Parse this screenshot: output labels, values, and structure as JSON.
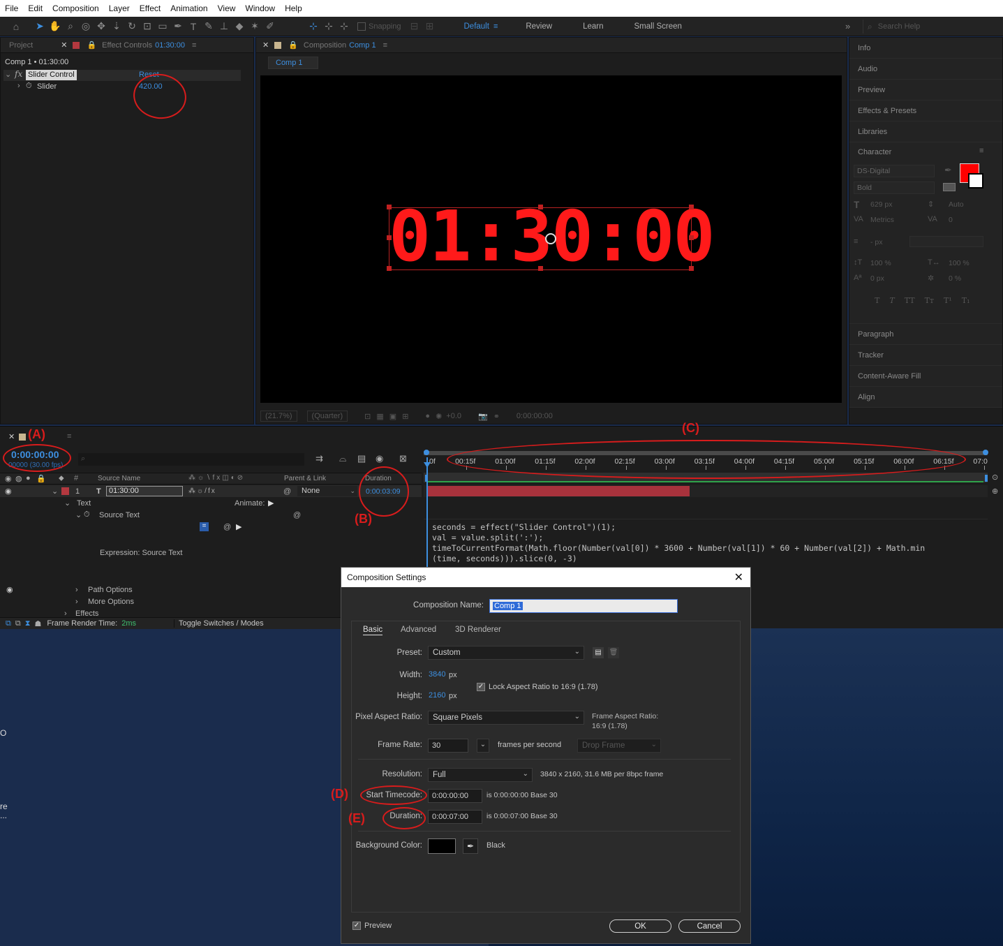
{
  "menu": [
    "File",
    "Edit",
    "Composition",
    "Layer",
    "Effect",
    "Animation",
    "View",
    "Window",
    "Help"
  ],
  "toolbar": {
    "snapping": "Snapping",
    "workspaces": [
      "Default",
      "Review",
      "Learn",
      "Small Screen"
    ],
    "search_placeholder": "Search Help"
  },
  "project_panel": {
    "tab_project": "Project",
    "tab_effect_controls": "Effect Controls",
    "effect_layer": "01:30:00",
    "comp_label": "Comp 1 • 01:30:00",
    "effect_name": "Slider Control",
    "reset": "Reset",
    "slider_label": "Slider",
    "slider_value": "420.00"
  },
  "composition_panel": {
    "tab_label": "Composition",
    "comp_name": "Comp 1",
    "sub_tab": "Comp 1",
    "display_text": "01:30:00",
    "zoom": "(21.7%)",
    "resolution": "(Quarter)",
    "exposure": "+0.0",
    "timecode": "0:00:00:00"
  },
  "right_panels": {
    "items_top": [
      "Info",
      "Audio",
      "Preview",
      "Effects & Presets",
      "Libraries"
    ],
    "character": {
      "title": "Character",
      "font": "DS-Digital",
      "style": "Bold",
      "size": "629 px",
      "leading": "Auto",
      "kerning": "Metrics",
      "tracking": "0",
      "stroke": "- px",
      "vscale": "100 %",
      "hscale": "100 %",
      "baseline": "0 px",
      "tsume": "0 %",
      "fill_color": "#ff0000",
      "styles": [
        "T",
        "T",
        "TT",
        "Tт",
        "T¹",
        "T₁"
      ]
    },
    "items_bottom": [
      "Paragraph",
      "Tracker",
      "Content-Aware Fill",
      "Align"
    ]
  },
  "timeline": {
    "current_time": "0:00:00:00",
    "frames_fps": "00000 (30.00 fps)",
    "col_source_name": "Source Name",
    "col_parent": "Parent & Link",
    "col_duration": "Duration",
    "layer_number": "1",
    "layer_name": "01:30:00",
    "parent_value": "None",
    "layer_duration": "0:00:03:09",
    "text_group": "Text",
    "animate_label": "Animate:",
    "source_text": "Source Text",
    "expression_label": "Expression: Source Text",
    "path_options": "Path Options",
    "more_options": "More Options",
    "effects": "Effects",
    "frame_render_label": "Frame Render Time:",
    "frame_render_value": "2ms",
    "toggle_label": "Toggle Switches / Modes",
    "ruler_labels": [
      "0f",
      "00:15f",
      "01:00f",
      "01:15f",
      "02:00f",
      "02:15f",
      "03:00f",
      "03:15f",
      "04:00f",
      "04:15f",
      "05:00f",
      "05:15f",
      "06:00f",
      "06:15f",
      "07:0"
    ],
    "expression_lines": [
      "seconds = effect(\"Slider Control\")(1);",
      "val = value.split(':');",
      "timeToCurrentFormat(Math.floor(Number(val[0]) * 3600 + Number(val[1]) * 60 + Number(val[2]) + Math.min",
      "(time, seconds))).slice(0, -3)"
    ],
    "bar_color": "#a8323c"
  },
  "annotations": [
    "(A)",
    "(B)",
    "(C)",
    "(D)",
    "(E)"
  ],
  "desktop_fragments": [
    "O",
    "re",
    "..."
  ],
  "dialog": {
    "title": "Composition Settings",
    "comp_name_label": "Composition Name:",
    "comp_name_value": "Comp 1",
    "tabs": [
      "Basic",
      "Advanced",
      "3D Renderer"
    ],
    "preset_label": "Preset:",
    "preset_value": "Custom",
    "width_label": "Width:",
    "width_value": "3840",
    "height_label": "Height:",
    "height_value": "2160",
    "px": "px",
    "lock_aspect": "Lock Aspect Ratio to 16:9 (1.78)",
    "par_label": "Pixel Aspect Ratio:",
    "par_value": "Square Pixels",
    "far_label": "Frame Aspect Ratio:",
    "far_value": "16:9 (1.78)",
    "fps_label": "Frame Rate:",
    "fps_value": "30",
    "fps_unit": "frames per second",
    "drop_frame": "Drop Frame",
    "res_label": "Resolution:",
    "res_value": "Full",
    "res_info": "3840 x 2160, 31.6 MB per 8bpc frame",
    "start_label": "Start Timecode:",
    "start_value": "0:00:00:00",
    "start_info": "is 0:00:00:00  Base 30",
    "dur_label": "Duration:",
    "dur_value": "0:00:07:00",
    "dur_info": "is 0:00:07:00  Base 30",
    "bg_label": "Background Color:",
    "bg_name": "Black",
    "preview_label": "Preview",
    "ok": "OK",
    "cancel": "Cancel"
  }
}
